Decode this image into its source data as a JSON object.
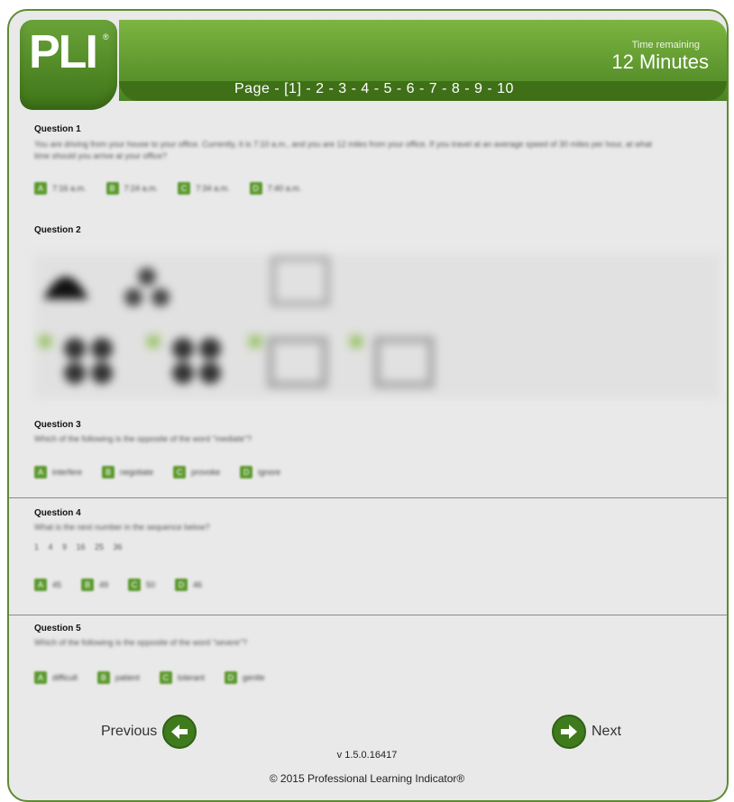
{
  "header": {
    "logo_text": "PLI",
    "time_label": "Time remaining",
    "time_value": "12 Minutes",
    "pager": {
      "prefix": "Page - ",
      "current": "[1]",
      "pages": [
        "2",
        "3",
        "4",
        "5",
        "6",
        "7",
        "8",
        "9",
        "10"
      ]
    }
  },
  "questions": [
    {
      "title": "Question 1",
      "text": "You are driving from your house to your office. Currently, it is 7:10 a.m., and you are 12 miles from your office. If you travel at an average speed of 30 miles per hour, at what time should you arrive at your office?",
      "options": [
        {
          "key": "A",
          "label": "7:16 a.m."
        },
        {
          "key": "B",
          "label": "7:24 a.m."
        },
        {
          "key": "C",
          "label": "7:34 a.m."
        },
        {
          "key": "D",
          "label": "7:40 a.m."
        }
      ]
    },
    {
      "title": "Question 2"
    },
    {
      "title": "Question 3",
      "text": "Which of the following is the opposite of the word \"mediate\"?",
      "options": [
        {
          "key": "A",
          "label": "interfere"
        },
        {
          "key": "B",
          "label": "negotiate"
        },
        {
          "key": "C",
          "label": "provoke"
        },
        {
          "key": "D",
          "label": "ignore"
        }
      ]
    },
    {
      "title": "Question 4",
      "text": "What is the next number in the sequence below?",
      "sequence": "1 4 9 16 25 36",
      "options": [
        {
          "key": "A",
          "label": "45"
        },
        {
          "key": "B",
          "label": "49"
        },
        {
          "key": "C",
          "label": "50"
        },
        {
          "key": "D",
          "label": "46"
        }
      ]
    },
    {
      "title": "Question 5",
      "text": "Which of the following is the opposite of the word \"severe\"?",
      "options": [
        {
          "key": "A",
          "label": "difficult"
        },
        {
          "key": "B",
          "label": "patient"
        },
        {
          "key": "C",
          "label": "tolerant"
        },
        {
          "key": "D",
          "label": "gentle"
        }
      ]
    }
  ],
  "nav": {
    "previous": "Previous",
    "next": "Next"
  },
  "footer": {
    "version": "v 1.5.0.16417",
    "copyright": "© 2015 Professional Learning Indicator®"
  },
  "colors": {
    "brand": "#5d9a2f",
    "dark_brand": "#3f7018",
    "background": "#e9e9e9"
  }
}
